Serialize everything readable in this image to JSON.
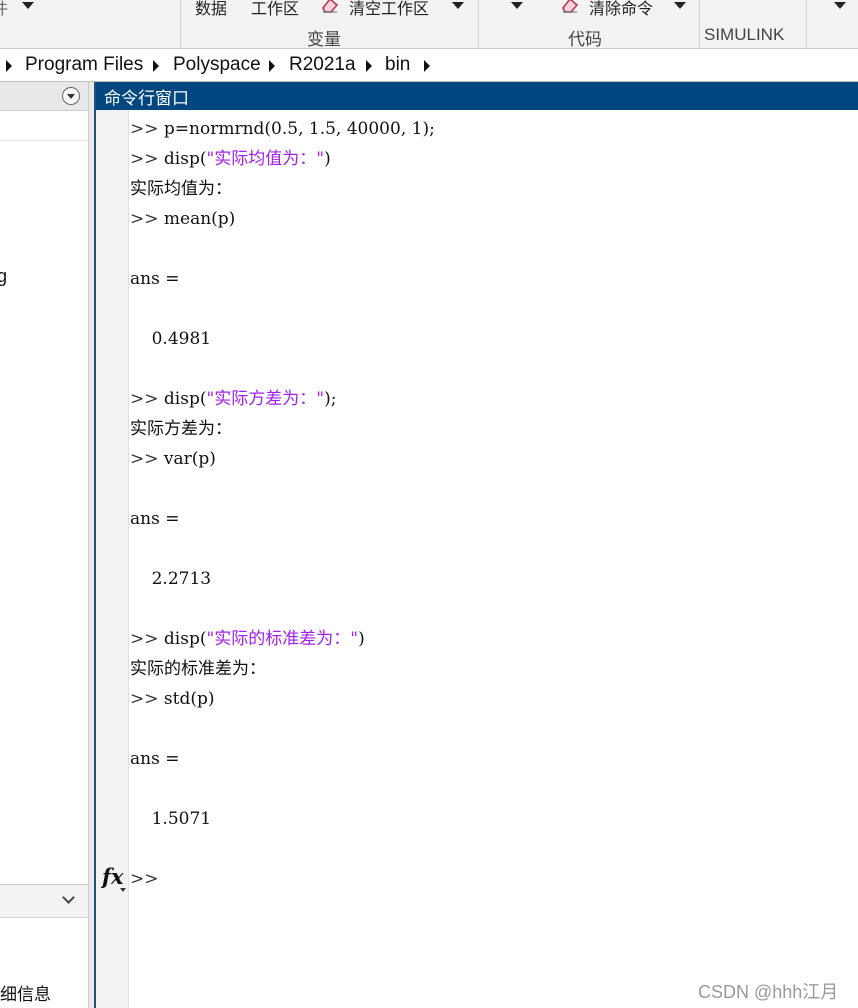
{
  "toolstrip": {
    "partial_left": "件",
    "data_label": "数据",
    "workspace_label": "工作区",
    "clear_workspace_label": "清空工作区",
    "section_variable": "变量",
    "clear_commands_label": "清除命令",
    "section_code": "代码",
    "section_simulink": "SIMULINK"
  },
  "address": {
    "crumbs": [
      "Program Files",
      "Polyspace",
      "R2021a",
      "bin"
    ]
  },
  "left_panel": {
    "partial_item": "g",
    "partial_info": "细信息"
  },
  "command_window": {
    "title": "命令行窗口",
    "lines": [
      {
        "prompt": ">> ",
        "code": "p=normrnd(0.5, 1.5, 40000, 1);",
        "str": "",
        "tail": ""
      },
      {
        "prompt": ">> ",
        "code": "disp(",
        "str": "\"实际均值为：\"",
        "tail": ")"
      },
      {
        "prompt": "",
        "code": "实际均值为：",
        "str": "",
        "tail": ""
      },
      {
        "prompt": ">> ",
        "code": "mean(p)",
        "str": "",
        "tail": ""
      },
      {
        "prompt": "",
        "code": "",
        "str": "",
        "tail": ""
      },
      {
        "prompt": "",
        "code": "ans =",
        "str": "",
        "tail": ""
      },
      {
        "prompt": "",
        "code": "",
        "str": "",
        "tail": ""
      },
      {
        "prompt": "",
        "code": "    0.4981",
        "str": "",
        "tail": ""
      },
      {
        "prompt": "",
        "code": "",
        "str": "",
        "tail": ""
      },
      {
        "prompt": ">> ",
        "code": "disp(",
        "str": "\"实际方差为：\"",
        "tail": ");"
      },
      {
        "prompt": "",
        "code": "实际方差为：",
        "str": "",
        "tail": ""
      },
      {
        "prompt": ">> ",
        "code": "var(p)",
        "str": "",
        "tail": ""
      },
      {
        "prompt": "",
        "code": "",
        "str": "",
        "tail": ""
      },
      {
        "prompt": "",
        "code": "ans =",
        "str": "",
        "tail": ""
      },
      {
        "prompt": "",
        "code": "",
        "str": "",
        "tail": ""
      },
      {
        "prompt": "",
        "code": "    2.2713",
        "str": "",
        "tail": ""
      },
      {
        "prompt": "",
        "code": "",
        "str": "",
        "tail": ""
      },
      {
        "prompt": ">> ",
        "code": "disp(",
        "str": "\"实际的标准差为：\"",
        "tail": ")"
      },
      {
        "prompt": "",
        "code": "实际的标准差为：",
        "str": "",
        "tail": ""
      },
      {
        "prompt": ">> ",
        "code": "std(p)",
        "str": "",
        "tail": ""
      },
      {
        "prompt": "",
        "code": "",
        "str": "",
        "tail": ""
      },
      {
        "prompt": "",
        "code": "ans =",
        "str": "",
        "tail": ""
      },
      {
        "prompt": "",
        "code": "",
        "str": "",
        "tail": ""
      },
      {
        "prompt": "",
        "code": "    1.5071",
        "str": "",
        "tail": ""
      },
      {
        "prompt": "",
        "code": "",
        "str": "",
        "tail": ""
      },
      {
        "prompt": ">> ",
        "code": "",
        "str": "",
        "tail": ""
      }
    ],
    "fx_label": "fx"
  },
  "watermark": "CSDN @hhh江月"
}
